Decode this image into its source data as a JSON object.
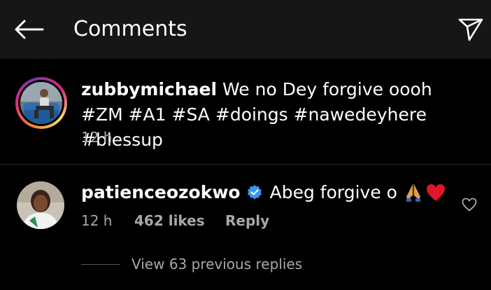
{
  "header": {
    "title": "Comments",
    "back_icon": "arrow-left-icon",
    "share_icon": "send-icon"
  },
  "caption": {
    "username": "zubbymichael",
    "text_main": " We no Dey forgive oooh ",
    "hashtags": [
      "#ZM",
      "#A1",
      "#SA",
      "#doings",
      "#nawedeyhere",
      "#blessup"
    ],
    "time": "12 h"
  },
  "comment": {
    "username": "patienceozokwo",
    "verified": true,
    "text": "Abeg forgive o",
    "emojis": [
      "folded-hands-icon",
      "red-heart-icon"
    ],
    "time": "12 h",
    "likes": "462 likes",
    "reply_label": "Reply",
    "like_icon": "heart-outline-icon"
  },
  "view_replies": {
    "label": "View 63 previous replies"
  },
  "colors": {
    "background": "#000000",
    "header_bg": "#161616",
    "muted_text": "#a8a8a8",
    "verified_blue": "#3897f0"
  }
}
